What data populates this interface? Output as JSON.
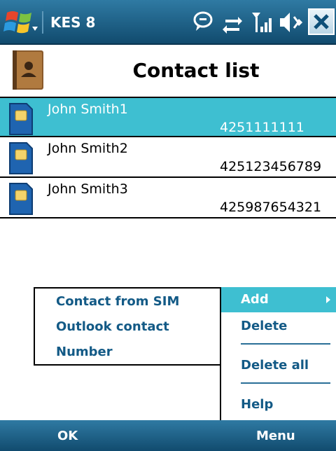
{
  "statusbar": {
    "app_title": "KES 8",
    "icons": [
      "windows-start-icon",
      "notification-bubble-icon",
      "sync-arrows-icon",
      "signal-strength-icon",
      "speaker-volume-icon",
      "close-icon"
    ]
  },
  "header": {
    "title": "Contact list",
    "icon": "address-book-icon"
  },
  "contacts": [
    {
      "name": "John Smith1",
      "number": "4251111111",
      "selected": true
    },
    {
      "name": "John Smith2",
      "number": "425123456789",
      "selected": false
    },
    {
      "name": "John Smith3",
      "number": "425987654321",
      "selected": false
    }
  ],
  "submenu": {
    "items": [
      "Contact from SIM",
      "Outlook contact",
      "Number"
    ]
  },
  "menu": {
    "items": [
      "Add",
      "Delete",
      "Delete all",
      "Help"
    ],
    "highlighted": "Add"
  },
  "softkeys": {
    "left": "OK",
    "right": "Menu"
  },
  "colors": {
    "bar_dark": "#114b6e",
    "bar_light": "#2f7aa3",
    "selection": "#3ebfd1",
    "menu_text": "#135a86"
  }
}
